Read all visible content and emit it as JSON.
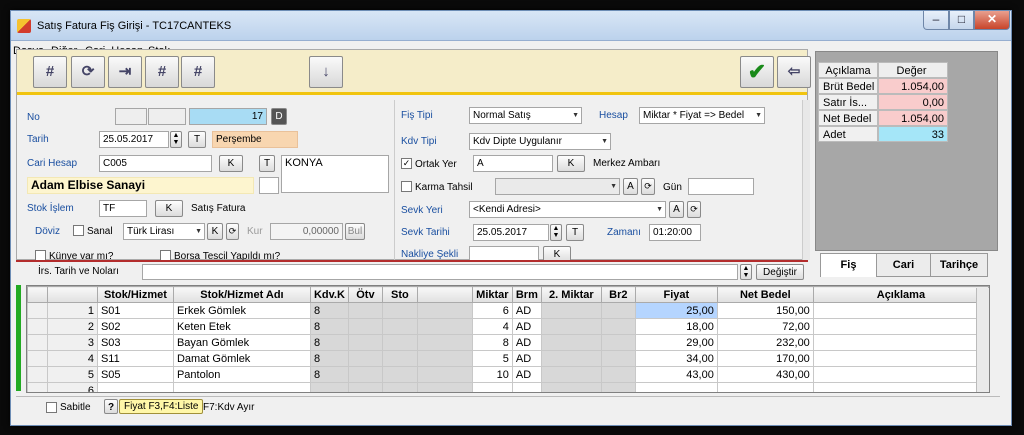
{
  "window": {
    "title": "Satış Fatura Fiş Girişi - TC17CANTEKS"
  },
  "menu": [
    "Dosya",
    "Diğer",
    "Cari_Hesap",
    "Stok"
  ],
  "form": {
    "no_label": "No",
    "no_value": "17",
    "no_btn": "D",
    "tarih_label": "Tarih",
    "tarih_value": "25.05.2017",
    "tarih_btn": "T",
    "gun_value": "Perşembe",
    "cari_label": "Cari Hesap",
    "cari_value": "C005",
    "k_btn": "K",
    "t_btn": "T",
    "cari_city": "KONYA",
    "cari_name": "Adam Elbise Sanayi",
    "stok_label": "Stok İşlem",
    "stok_value": "TF",
    "stok_desc": "Satış Fatura",
    "doviz_label": "Döviz",
    "sanal_label": "Sanal",
    "doviz_value": "Türk Lirası",
    "kur_label": "Kur",
    "kur_value": "0,00000",
    "bul_btn": "Bul",
    "kunye_label": "Künye var mı?",
    "borsa_label": "Borsa Tescil Yapıldı mı?",
    "fis_tipi_label": "Fiş Tipi",
    "fis_tipi_value": "Normal Satış",
    "hesap_label": "Hesap",
    "hesap_value": "Miktar * Fiyat => Bedel",
    "kdv_tipi_label": "Kdv Tipi",
    "kdv_tipi_value": "Kdv Dipte Uygulanır",
    "ortak_yer_label": "Ortak Yer",
    "ortak_yer_value": "A",
    "ortak_yer_desc": "Merkez Ambarı",
    "karma_label": "Karma Tahsil",
    "a_btn": "A",
    "gun_label": "Gün",
    "sevk_yeri_label": "Sevk Yeri",
    "sevk_yeri_value": "<Kendi Adresi>",
    "sevk_tarihi_label": "Sevk Tarihi",
    "sevk_tarihi_value": "25.05.2017",
    "zamani_label": "Zamanı",
    "zamani_value": "01:20:00",
    "nakliye_label": "Nakliye Şekli",
    "irs_label": "İrs. Tarih ve Noları",
    "degistir_btn": "Değiştir"
  },
  "summary": {
    "headers": [
      "Açıklama",
      "Değer"
    ],
    "rows": [
      {
        "label": "Brüt Bedel",
        "value": "1.054,00"
      },
      {
        "label": "Satır İs...",
        "value": "0,00"
      },
      {
        "label": "Net Bedel",
        "value": "1.054,00"
      },
      {
        "label": "Adet",
        "value": "33"
      }
    ]
  },
  "tabs": [
    "Fiş",
    "Cari",
    "Tarihçe"
  ],
  "grid": {
    "headers": [
      "",
      "Stok/Hizmet",
      "Stok/Hizmet Adı",
      "Kdv.K",
      "Ötv",
      "Sto",
      "",
      "Miktar",
      "Brm",
      "2. Miktar",
      "Br2",
      "Fiyat",
      "Net Bedel",
      "Açıklama"
    ],
    "rows": [
      {
        "no": "1",
        "kod": "S01",
        "ad": "Erkek Gömlek",
        "kdv": "8",
        "miktar": "6",
        "brm": "AD",
        "fiyat": "25,00",
        "net": "150,00"
      },
      {
        "no": "2",
        "kod": "S02",
        "ad": "Keten Etek",
        "kdv": "8",
        "miktar": "4",
        "brm": "AD",
        "fiyat": "18,00",
        "net": "72,00"
      },
      {
        "no": "3",
        "kod": "S03",
        "ad": "Bayan Gömlek",
        "kdv": "8",
        "miktar": "8",
        "brm": "AD",
        "fiyat": "29,00",
        "net": "232,00"
      },
      {
        "no": "4",
        "kod": "S11",
        "ad": "Damat Gömlek",
        "kdv": "8",
        "miktar": "5",
        "brm": "AD",
        "fiyat": "34,00",
        "net": "170,00"
      },
      {
        "no": "5",
        "kod": "S05",
        "ad": "Pantolon",
        "kdv": "8",
        "miktar": "10",
        "brm": "AD",
        "fiyat": "43,00",
        "net": "430,00"
      },
      {
        "no": "6",
        "kod": "",
        "ad": "",
        "kdv": "",
        "miktar": "",
        "brm": "",
        "fiyat": "",
        "net": ""
      }
    ]
  },
  "status": {
    "sabitle": "Sabitle",
    "help": "?",
    "tooltip": "Fiyat F3,F4:Liste",
    "hint": "F7:Kdv Ayır"
  }
}
